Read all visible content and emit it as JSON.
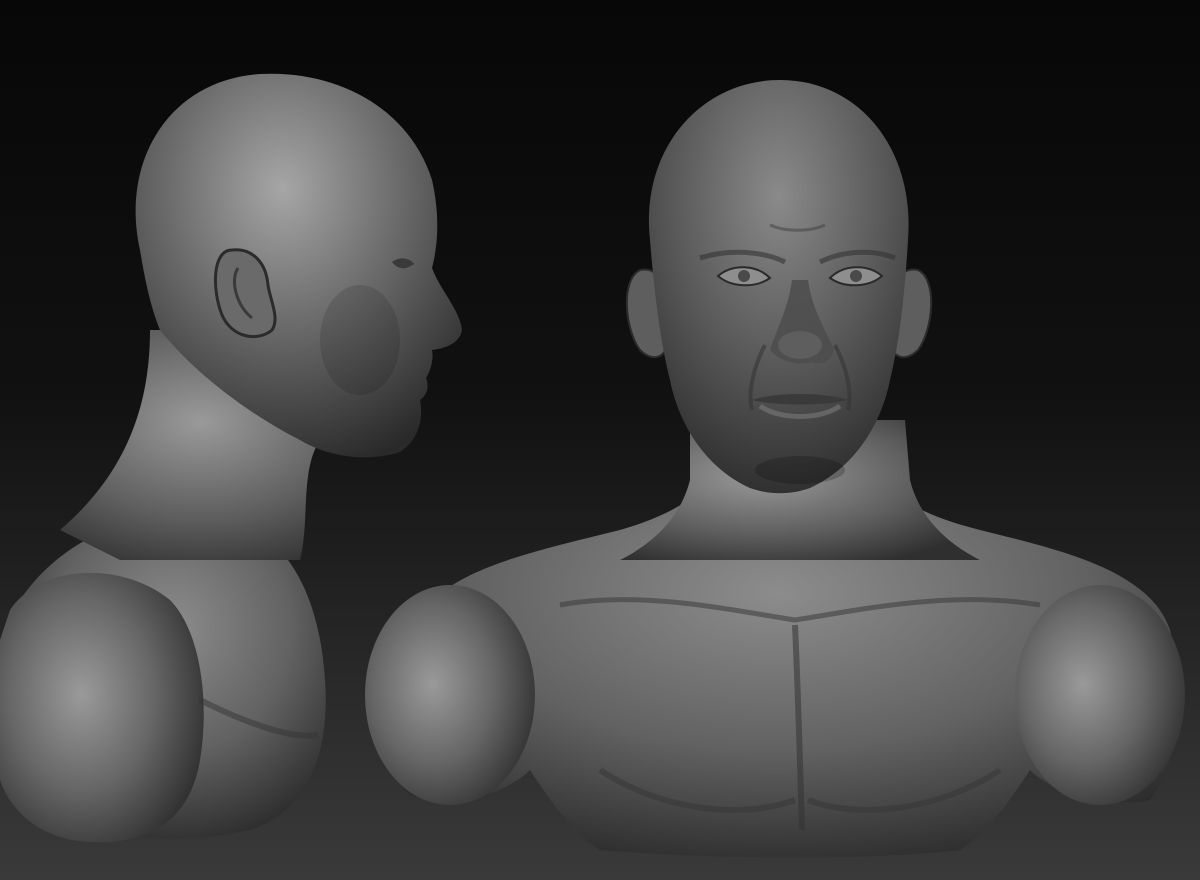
{
  "scene": {
    "colors": {
      "background_top": "#070707",
      "background_bottom": "#3a3a3a",
      "clay_highlight": "#a6a6a6",
      "clay_mid": "#6e6e6e",
      "clay_shadow": "#2a2a2a"
    },
    "views": [
      {
        "id": "side-view",
        "angle": "profile"
      },
      {
        "id": "front-view",
        "angle": "frontal"
      }
    ]
  }
}
